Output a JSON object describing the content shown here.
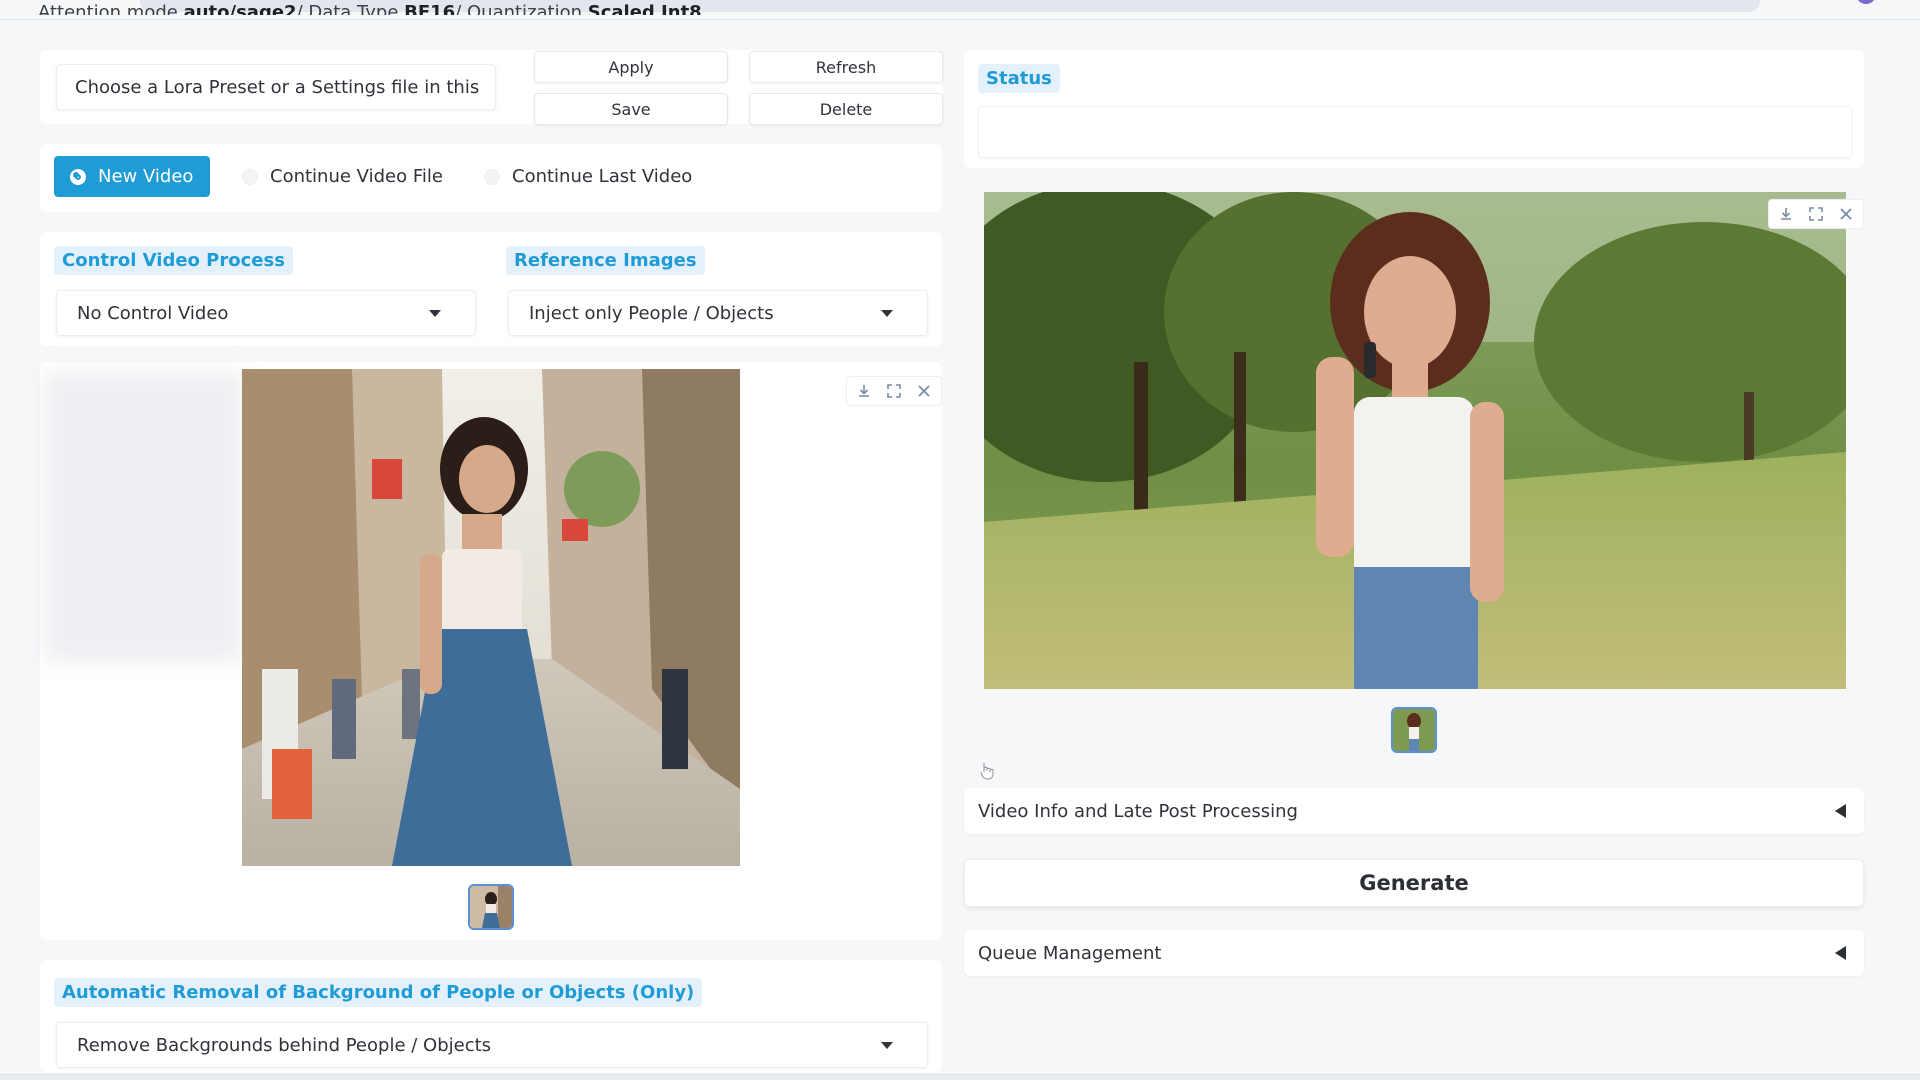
{
  "header": {
    "info_prefix": "Attention mode ",
    "attention_mode": "auto/sage2",
    "data_type_label": "/ Data Type ",
    "data_type": "BF16",
    "quant_label": "/ Quantization ",
    "quantization": "Scaled Int8"
  },
  "lora": {
    "preset_placeholder": "Choose a Lora Preset or a Settings file in this",
    "apply_label": "Apply",
    "refresh_label": "Refresh",
    "save_label": "Save",
    "delete_label": "Delete"
  },
  "video_mode": {
    "options": [
      "New Video",
      "Continue Video File",
      "Continue Last Video"
    ],
    "selected": "New Video"
  },
  "control_video": {
    "label": "Control Video Process",
    "value": "No Control Video"
  },
  "reference_images": {
    "label": "Reference Images",
    "value": "Inject only People / Objects"
  },
  "background_removal": {
    "label": "Automatic Removal of Background of People or Objects (Only)",
    "value": "Remove Backgrounds behind People / Objects"
  },
  "status": {
    "label": "Status",
    "text": ""
  },
  "output": {
    "video_info_label": "Video Info and Late Post Processing",
    "generate_label": "Generate",
    "queue_label": "Queue Management"
  },
  "icons": {
    "download": "download-icon",
    "fullscreen": "fullscreen-icon",
    "close": "close-icon",
    "dropdown": "chevron-down-icon",
    "collapse": "triangle-left-icon"
  },
  "colors": {
    "accent": "#1f9bd6",
    "label_bg": "#e4f1fb",
    "page_bg": "#f6f7f9"
  }
}
